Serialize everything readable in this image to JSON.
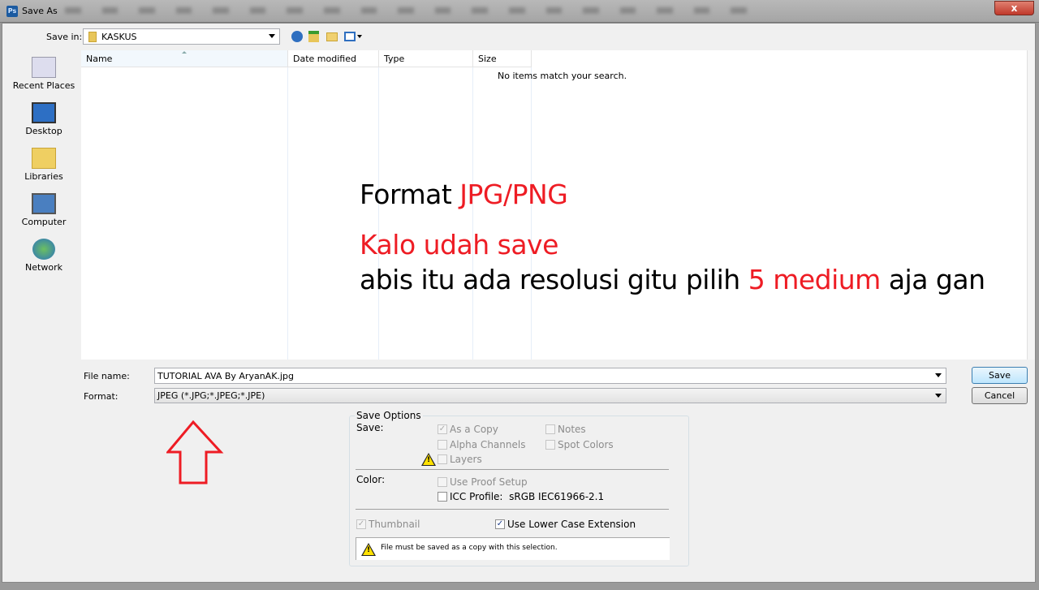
{
  "window": {
    "title": "Save As",
    "app_icon": "Ps",
    "close_label": "x"
  },
  "save_in": {
    "label": "Save in:",
    "value": "KASKUS"
  },
  "places": [
    {
      "label": "Recent Places"
    },
    {
      "label": "Desktop"
    },
    {
      "label": "Libraries"
    },
    {
      "label": "Computer"
    },
    {
      "label": "Network"
    }
  ],
  "columns": [
    "Name",
    "Date modified",
    "Type",
    "Size"
  ],
  "empty_message": "No items match your search.",
  "file_name": {
    "label": "File name:",
    "value": "TUTORIAL AVA By AryanAK.jpg"
  },
  "format": {
    "label": "Format:",
    "value": "JPEG (*.JPG;*.JPEG;*.JPE)"
  },
  "buttons": {
    "save": "Save",
    "cancel": "Cancel"
  },
  "save_options": {
    "title": "Save Options",
    "save_label": "Save:",
    "as_a_copy": {
      "label": "As a Copy",
      "checked": true,
      "disabled": true
    },
    "notes": {
      "label": "Notes",
      "checked": false
    },
    "alpha": {
      "label": "Alpha Channels",
      "checked": false
    },
    "spot": {
      "label": "Spot Colors",
      "checked": false
    },
    "layers": {
      "label": "Layers",
      "checked": false
    },
    "color_label": "Color:",
    "proof": {
      "label": "Use Proof Setup",
      "checked": false
    },
    "icc": {
      "label": "ICC Profile:",
      "value": "sRGB IEC61966-2.1",
      "checked": false
    },
    "thumbnail": {
      "label": "Thumbnail",
      "checked": true,
      "disabled": true
    },
    "lower_case": {
      "label": "Use Lower Case Extension",
      "checked": true
    },
    "warning": "File must be saved as a copy with this selection."
  },
  "annotation": {
    "line1_a": "Format ",
    "line1_b": "JPG/PNG",
    "line2": "Kalo udah save",
    "line3_a": "abis itu ada resolusi gitu pilih ",
    "line3_b": "5 medium",
    "line3_c": " aja gan",
    "accent": "#ee1c24"
  }
}
